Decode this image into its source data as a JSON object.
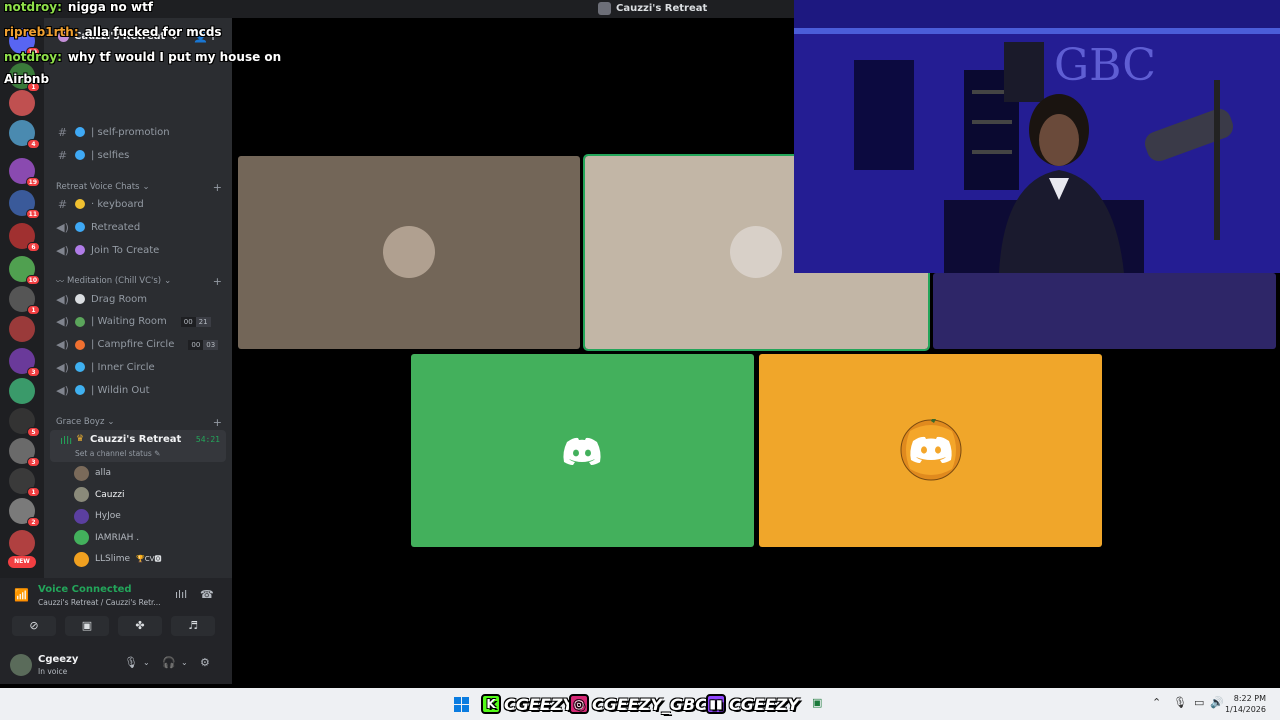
{
  "window": {
    "title": "Cauzzi's Retreat"
  },
  "server": {
    "name": "Cauzzi's Retreat"
  },
  "chat_overlay": [
    {
      "user": "notdroy:",
      "text": "nigga no wtf",
      "color": "#8fe04a"
    },
    {
      "user": "ripreb1rth:",
      "text": "alla fucked for mcds",
      "color": "#f0a030"
    },
    {
      "user": "notdroy:",
      "text": "why tf would I put my house on",
      "color": "#8fe04a"
    },
    {
      "user": "",
      "text": "Airbnb",
      "color": "#ffffff"
    }
  ],
  "channels_top": [
    {
      "label": "| self-promotion",
      "prefix": "#",
      "emoji_color": "#3fa9f5"
    },
    {
      "label": "| selfies",
      "prefix": "#",
      "emoji_color": "#3fa9f5"
    }
  ],
  "category_retreat": "Retreat Voice Chats",
  "channels_retreat": [
    {
      "label": "· keyboard",
      "prefix": "#",
      "emoji_color": "#f0c030"
    },
    {
      "label": "Retreated",
      "prefix": "🔊",
      "emoji_color": "#3fa9f5"
    },
    {
      "label": "Join To Create",
      "prefix": "🔊",
      "emoji_color": "#b07ce8"
    }
  ],
  "category_meditation": "Meditation (Chill VC's)",
  "channels_meditation": [
    {
      "label": "Drag Room",
      "prefix": "🔊",
      "emoji_color": "#dbdee1",
      "count": null
    },
    {
      "label": "| Waiting Room",
      "prefix": "🔊",
      "emoji_color": "#5ba55b",
      "count": [
        "00",
        "21"
      ]
    },
    {
      "label": "| Campfire Circle",
      "prefix": "🔊",
      "emoji_color": "#f07030",
      "count": [
        "00",
        "03"
      ]
    },
    {
      "label": "| Inner Circle",
      "prefix": "🔊",
      "emoji_color": "#3fb0f0",
      "count": null
    },
    {
      "label": "| Wildin Out",
      "prefix": "🔊",
      "emoji_color": "#3fb0f0",
      "count": null
    }
  ],
  "category_grace": "Grace Boyz",
  "active_channel": {
    "name": "Cauzzi's Retreat",
    "timer": "54:21",
    "status": "Set a channel status"
  },
  "voice_users": [
    {
      "name": "alla",
      "color": "#7a6a5a"
    },
    {
      "name": "Cauzzi",
      "color": "#8a8a7a"
    },
    {
      "name": "HyJoe",
      "color": "#5b3fa0"
    },
    {
      "name": "IAMRIAH .",
      "color": "#43b05c"
    },
    {
      "name": "LLSlime",
      "color": "#f0a020",
      "tags": "🏆CV🅾"
    }
  ],
  "voice_panel": {
    "status": "Voice Connected",
    "sub": "Cauzzi's Retreat / Cauzzi's Retr..."
  },
  "user": {
    "name": "Cgeezy",
    "status": "In voice"
  },
  "servers": [
    {
      "color": "#5865f2",
      "badge": "19"
    },
    {
      "color": "#3a7a3a",
      "badge": "1"
    },
    {
      "color": "#c05050",
      "badge": ""
    },
    {
      "color": "#4a8ab0",
      "badge": "4"
    },
    {
      "color": "#8a4ab0",
      "badge": "19"
    },
    {
      "color": "#3a5a9a",
      "badge": "11"
    },
    {
      "color": "#a03030",
      "badge": "6"
    },
    {
      "color": "#50a050",
      "badge": "10"
    },
    {
      "color": "#555555",
      "badge": "1"
    },
    {
      "color": "#9a3a3a",
      "badge": ""
    },
    {
      "color": "#6a3a9a",
      "badge": "3"
    },
    {
      "color": "#3a9a6a",
      "badge": ""
    },
    {
      "color": "#333333",
      "badge": "5"
    },
    {
      "color": "#6a6a6a",
      "badge": "3"
    },
    {
      "color": "#3a3a3a",
      "badge": "1"
    },
    {
      "color": "#7a7a7a",
      "badge": "2"
    },
    {
      "color": "#b04040",
      "badge": ""
    }
  ],
  "new_label": "NEW",
  "tiles": [
    {
      "bg": "#736658",
      "type": "avatar",
      "av_color": "#b0a090"
    },
    {
      "bg": "#c2b6a6",
      "type": "avatar",
      "av_color": "#d8d0c8",
      "speaking": true
    },
    {
      "bg": "#2e2668",
      "type": "none"
    },
    {
      "bg": "#43b05c",
      "type": "discord"
    },
    {
      "bg": "#f0a62a",
      "type": "pumpkin"
    }
  ],
  "taskbar": {
    "brands": [
      {
        "name": "CGEEZY",
        "icon": "K",
        "icon_bg": "#53fc18"
      },
      {
        "name": "CGEEZY_GBC",
        "icon": "◎",
        "icon_bg": "#d62976"
      },
      {
        "name": "CGEEZY",
        "icon": "▮▮",
        "icon_bg": "#9146ff"
      }
    ],
    "time": "8:22 PM",
    "date": "1/14/2026"
  },
  "webcam": {
    "sign": "GBC"
  }
}
